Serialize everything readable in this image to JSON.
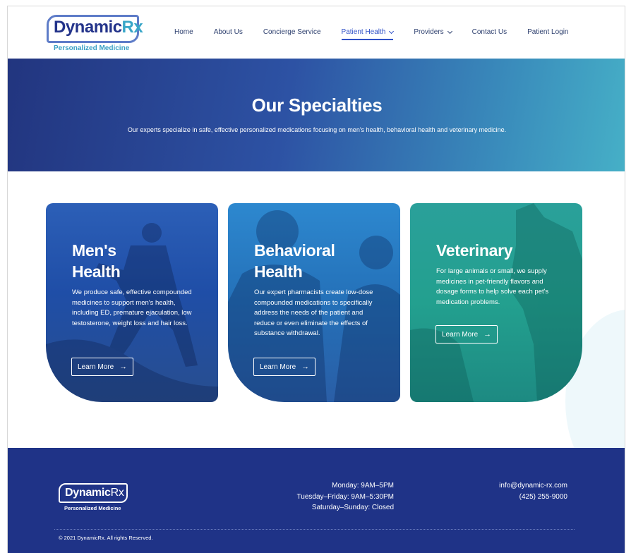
{
  "brand": {
    "name_main": "Dynamic",
    "name_rx": "Rx",
    "tagline": "Personalized Medicine"
  },
  "nav": {
    "items": [
      {
        "label": "Home",
        "has_menu": false,
        "active": false
      },
      {
        "label": "About Us",
        "has_menu": false,
        "active": false
      },
      {
        "label": "Concierge Service",
        "has_menu": false,
        "active": false
      },
      {
        "label": "Patient Health",
        "has_menu": true,
        "active": true
      },
      {
        "label": "Providers",
        "has_menu": true,
        "active": false
      },
      {
        "label": "Contact Us",
        "has_menu": false,
        "active": false
      },
      {
        "label": "Patient Login",
        "has_menu": false,
        "active": false
      }
    ]
  },
  "hero": {
    "title": "Our Specialties",
    "subtitle": "Our experts specialize in safe, effective personalized medications focusing on men's health, behavioral health and veterinary medicine."
  },
  "cards": [
    {
      "title_line1": "Men's",
      "title_line2": "Health",
      "text": "We produce safe, effective compounded medicines to support men's health, including ED, premature ejaculation, low testosterone, weight loss and hair loss.",
      "button": "Learn More"
    },
    {
      "title_line1": "Behavioral",
      "title_line2": "Health",
      "text": "Our expert pharmacists create low-dose compounded medications to specifically address the needs of the patient and reduce or even eliminate the effects of substance withdrawal.",
      "button": "Learn More"
    },
    {
      "title_line1": "Veterinary",
      "title_line2": "",
      "text": "For large animals or small, we supply medicines in pet-friendly flavors and dosage forms to help solve each pet's medication problems.",
      "button": "Learn More"
    }
  ],
  "footer": {
    "brand_main": "Dynamic",
    "brand_rx": "Rx",
    "tagline": "Personalized Medicine",
    "hours": [
      "Monday: 9AM–5PM",
      "Tuesday–Friday: 9AM–5:30PM",
      "Saturday–Sunday: Closed"
    ],
    "email": "info@dynamic-rx.com",
    "phone": "(425) 255-9000",
    "copyright": "© 2021 DynamicRx. All rights Reserved."
  },
  "colors": {
    "navy": "#1f3387",
    "accent": "#2f50c7",
    "teal": "#46b0c7"
  }
}
